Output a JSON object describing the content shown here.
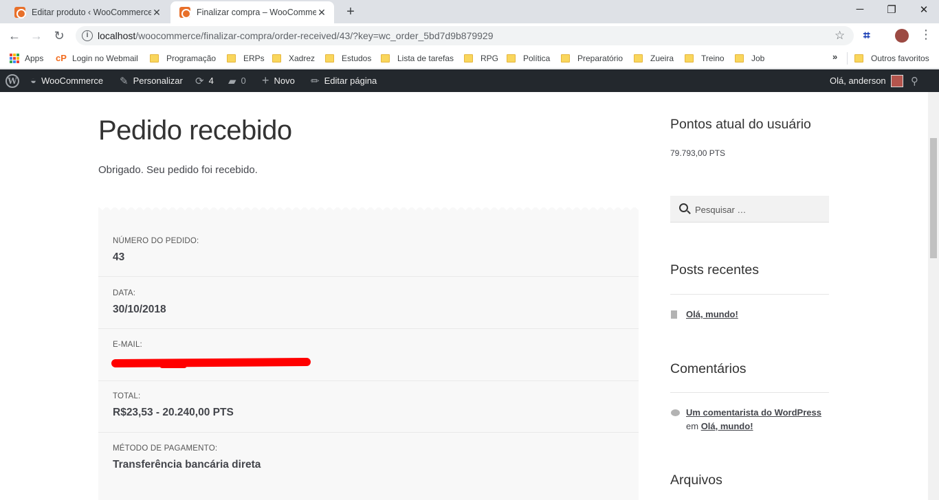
{
  "browser": {
    "tabs": [
      {
        "title": "Editar produto ‹ WooCommerce",
        "active": false
      },
      {
        "title": "Finalizar compra – WooCommerce",
        "active": true
      }
    ],
    "url_host": "localhost",
    "url_path": "/woocommerce/finalizar-compra/order-received/43/?key=wc_order_5bd7d9b879929",
    "bookmarks": [
      "Apps",
      "Login no Webmail",
      "Programação",
      "ERPs",
      "Xadrez",
      "Estudos",
      "Lista de tarefas",
      "RPG",
      "Política",
      "Preparatório",
      "Zueira",
      "Treino",
      "Job"
    ],
    "other_bookmarks": "Outros favoritos",
    "overflow_chevron": "»"
  },
  "adminbar": {
    "site": "WooCommerce",
    "customize": "Personalizar",
    "updates": "4",
    "comments": "0",
    "new": "Novo",
    "edit": "Editar página",
    "greeting": "Olá, anderson"
  },
  "page": {
    "title": "Pedido recebido",
    "thanks": "Obrigado. Seu pedido foi recebido."
  },
  "order": [
    {
      "label": "Número do pedido:",
      "value": "43"
    },
    {
      "label": "Data:",
      "value": "30/10/2018"
    },
    {
      "label": "E-mail:",
      "value": ""
    },
    {
      "label": "Total:",
      "value": "R$23,53 - 20.240,00 PTS"
    },
    {
      "label": "Método de pagamento:",
      "value": "Transferência bancária direta"
    }
  ],
  "sidebar": {
    "points_title": "Pontos atual do usuário",
    "points_value": "79.793,00 PTS",
    "search_placeholder": "Pesquisar …",
    "recent_posts_title": "Posts recentes",
    "recent_post": "Olá, mundo!",
    "comments_title": "Comentários",
    "comment_author": "Um comentarista do WordPress",
    "comment_em": "em",
    "comment_post": "Olá, mundo!",
    "archives_title": "Arquivos"
  },
  "colors": {
    "adminbar_bg": "#23282d",
    "redaction": "#ff0000",
    "tab_favicon": "#e8702a"
  }
}
